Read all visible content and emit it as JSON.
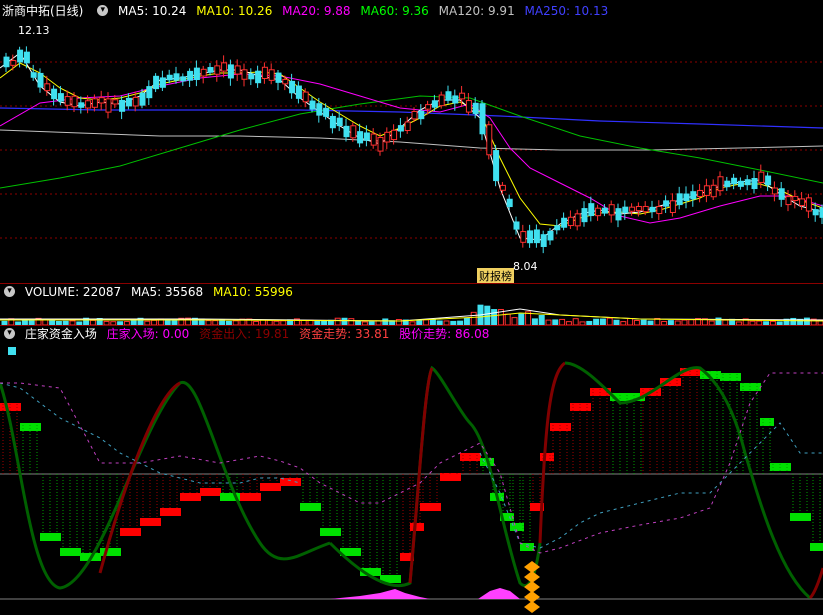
{
  "main_panel": {
    "title": "浙商中拓(日线)",
    "indicators": [
      {
        "label": "MA5: 10.24",
        "color": "#ffffff"
      },
      {
        "label": "MA10: 10.26",
        "color": "#ffff00"
      },
      {
        "label": "MA20: 9.88",
        "color": "#ff00ff"
      },
      {
        "label": "MA60: 9.36",
        "color": "#00ff00"
      },
      {
        "label": "MA120: 9.91",
        "color": "#c0c0c0"
      },
      {
        "label": "MA250: 10.13",
        "color": "#4040ff"
      }
    ],
    "high_label": "12.13",
    "low_label": "8.04",
    "event_tag": "财报榜"
  },
  "volume_panel": {
    "indicators": [
      {
        "label": "VOLUME: 22087",
        "color": "#ffffff"
      },
      {
        "label": "MA5: 35568",
        "color": "#ffffff"
      },
      {
        "label": "MA10: 55996",
        "color": "#ffff00"
      }
    ]
  },
  "indicator_panel": {
    "title": "庄家资金入场",
    "indicators": [
      {
        "label": "庄家入场: 0.00",
        "color": "#ff00ff"
      },
      {
        "label": "资金出入: 19.81",
        "color": "#8b0000"
      },
      {
        "label": "资金走势: 33.81",
        "color": "#ff4040"
      },
      {
        "label": "股价走势: 86.08",
        "color": "#ff00ff"
      }
    ]
  },
  "colors": {
    "up": "#ff3030",
    "down": "#40e0f0",
    "background": "#000000",
    "separator": "#8b0000",
    "green_bar": "#00e000",
    "red_bar": "#ff0000",
    "pink_area": "#ff40ff"
  }
}
